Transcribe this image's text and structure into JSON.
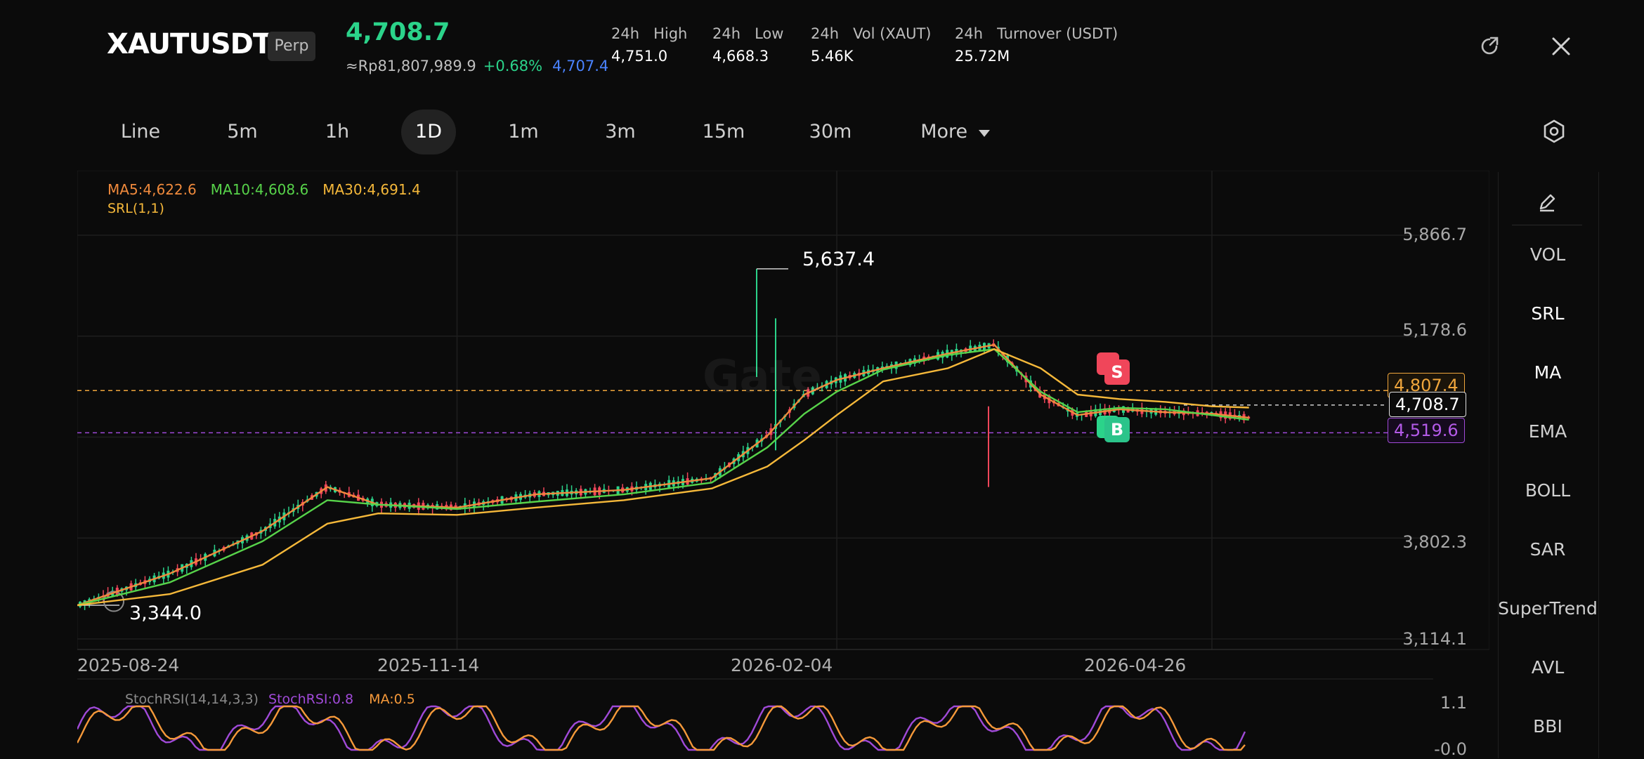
{
  "header": {
    "symbol": "XAUTUSDT",
    "contract_type": "Perp",
    "last_price": "4,708.7",
    "idr_price": "≈Rp81,807,989.9",
    "change_pct": "+0.68%",
    "mark_price": "4,707.4",
    "stats": [
      {
        "period": "24h",
        "label": "High",
        "value": "4,751.0"
      },
      {
        "period": "24h",
        "label": "Low",
        "value": "4,668.3"
      },
      {
        "period": "24h",
        "label": "Vol (XAUT)",
        "value": "5.46K"
      },
      {
        "period": "24h",
        "label": "Turnover (USDT)",
        "value": "25.72M"
      }
    ],
    "icons": {
      "share": "share-icon",
      "close": "close-icon"
    }
  },
  "timeframes": [
    "Line",
    "5m",
    "1h",
    "1D",
    "1m",
    "3m",
    "15m",
    "30m"
  ],
  "active_timeframe": "1D",
  "more_label": "More",
  "settings_icon": "hexagon-settings-icon",
  "legend": {
    "ma5": "MA5:4,622.6",
    "ma10": "MA10:4,608.6",
    "ma30": "MA30:4,691.4",
    "srl": "SRL(1,1)"
  },
  "watermark": "Gate",
  "stoch_legend": {
    "params": "StochRSI(14,14,3,3)",
    "value": "StochRSI:0.8",
    "ma": "MA:0.5"
  },
  "stoch_axis": [
    "1.1",
    "-0.0"
  ],
  "price_tags": {
    "resistance": "4,807.4",
    "current": "4,708.7",
    "support": "4,519.6"
  },
  "markers": {
    "sell": "S",
    "buy": "B"
  },
  "side_panel": [
    "VOL",
    "SRL",
    "MA",
    "EMA",
    "BOLL",
    "SAR",
    "SuperTrend",
    "AVL",
    "BBI"
  ],
  "side_panel_active": [
    "SRL",
    "MA"
  ],
  "colors": {
    "up": "#2bd38a",
    "down": "#f0465a",
    "ma5": "#f08a3c",
    "ma10": "#57d34a",
    "ma30": "#f5b83a",
    "srl_high": "#f0a63c",
    "srl_low": "#a04ad8",
    "stoch_k": "#a04ad8",
    "stoch_d": "#f5993a",
    "accent_blue": "#4a83ff"
  },
  "chart_data": {
    "type": "line",
    "title": "",
    "y_axis_labels": [
      "5,866.7",
      "5,178.6",
      "3,802.3",
      "3,114.1"
    ],
    "x_axis_labels": [
      "2025-08-24",
      "2025-11-14",
      "2026-02-04",
      "2026-04-26"
    ],
    "ylim": [
      3114.1,
      5866.7
    ],
    "high_label": "5,637.4",
    "low_label": "3,344.0",
    "x": [
      "2025-08-24",
      "2025-09-13",
      "2025-10-03",
      "2025-10-17",
      "2025-10-28",
      "2025-11-14",
      "2025-12-01",
      "2025-12-20",
      "2026-01-08",
      "2026-01-20",
      "2026-01-28",
      "2026-02-04",
      "2026-02-14",
      "2026-02-28",
      "2026-03-10",
      "2026-03-20",
      "2026-03-28",
      "2026-04-06",
      "2026-04-16",
      "2026-04-26",
      "2026-05-04"
    ],
    "series": [
      {
        "name": "MA5",
        "values": [
          3344,
          3560,
          3850,
          4150,
          4030,
          4010,
          4100,
          4130,
          4210,
          4500,
          4780,
          4880,
          4960,
          5060,
          5120,
          4780,
          4640,
          4680,
          4660,
          4650,
          4622.6
        ]
      },
      {
        "name": "MA10",
        "values": [
          3344,
          3500,
          3780,
          4060,
          4030,
          4000,
          4050,
          4100,
          4180,
          4420,
          4650,
          4800,
          4950,
          5050,
          5090,
          4800,
          4660,
          4690,
          4680,
          4640,
          4608.6
        ]
      },
      {
        "name": "MA30",
        "values": [
          3344,
          3420,
          3620,
          3900,
          3970,
          3960,
          4010,
          4060,
          4140,
          4290,
          4470,
          4640,
          4870,
          4960,
          5090,
          4960,
          4780,
          4750,
          4730,
          4700,
          4691.4
        ]
      }
    ],
    "stoch_rsi": {
      "ylim": [
        0,
        1.1
      ],
      "k_last": 0.8,
      "d_last": 0.5
    }
  }
}
